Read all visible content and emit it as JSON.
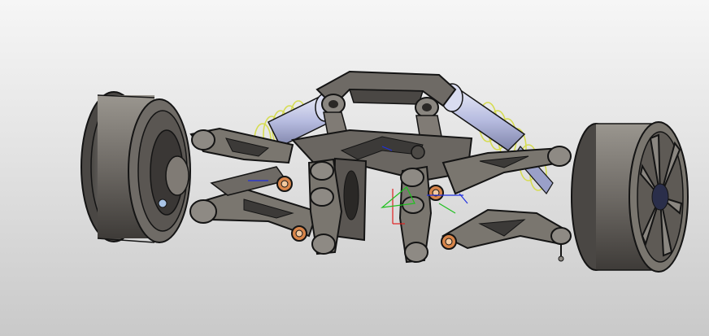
{
  "viewport": {
    "background_top": "#f6f6f6",
    "background_bottom": "#c9c9c9"
  },
  "model": {
    "description": "cad-assembly-suspension-axle",
    "colors": {
      "metal_light": "#8a8680",
      "metal_dark": "#3c3a38",
      "edge": "#141414",
      "shock_body": "#c4c8e6",
      "spring": "#d6dc52",
      "bolt": "#d8854a",
      "triad_x": "#e02020",
      "triad_y": "#20c020",
      "triad_z": "#2030e0"
    },
    "icons": [
      "coordinate-triad-icon"
    ]
  }
}
